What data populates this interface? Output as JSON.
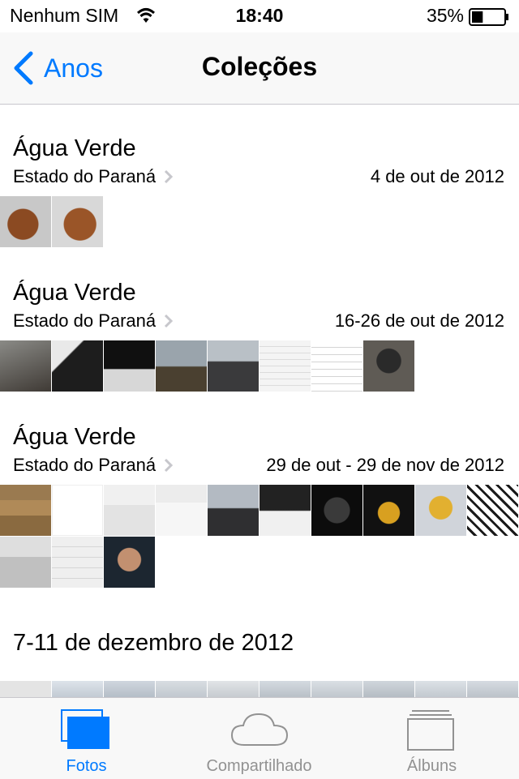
{
  "status_bar": {
    "carrier": "Nenhum SIM",
    "time": "18:40",
    "battery_percent": "35%",
    "battery_level": 0.35
  },
  "nav": {
    "back_label": "Anos",
    "title": "Coleções"
  },
  "moments": [
    {
      "title": "Água Verde",
      "subtitle": "Estado do Paraná",
      "date": "4 de out de 2012",
      "thumb_count": 2
    },
    {
      "title": "Água Verde",
      "subtitle": "Estado do Paraná",
      "date": "16-26 de out de 2012",
      "thumb_count": 8
    },
    {
      "title": "Água Verde",
      "subtitle": "Estado do Paraná",
      "date": "29 de out - 29 de nov de 2012",
      "thumb_count": 13
    }
  ],
  "moment4": {
    "title": "7-11 de dezembro de 2012"
  },
  "tabs": [
    {
      "label": "Fotos",
      "icon": "photos-icon",
      "active": true
    },
    {
      "label": "Compartilhado",
      "icon": "cloud-icon",
      "active": false
    },
    {
      "label": "Álbuns",
      "icon": "albums-icon",
      "active": false
    }
  ],
  "colors": {
    "accent": "#007aff",
    "inactive": "#929292",
    "separator": "#c8c7cc"
  }
}
